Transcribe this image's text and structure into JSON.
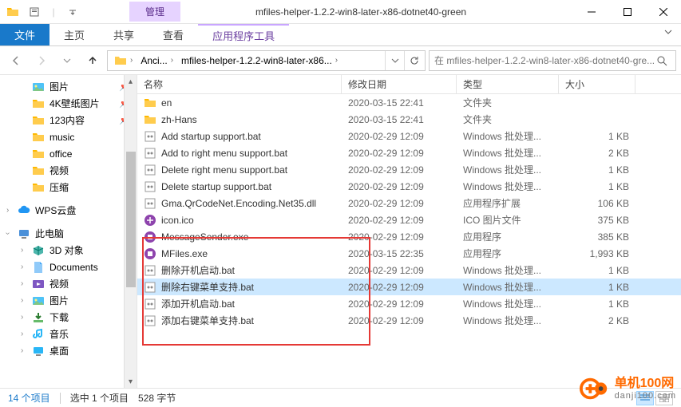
{
  "window": {
    "mgmt_tab": "管理",
    "title": "mfiles-helper-1.2.2-win8-later-x86-dotnet40-green",
    "tabs": {
      "file": "文件",
      "home": "主页",
      "share": "共享",
      "view": "查看",
      "app_tools": "应用程序工具"
    }
  },
  "address": {
    "segments": [
      "Anci...",
      "mfiles-helper-1.2.2-win8-later-x86..."
    ],
    "search_placeholder": "在 mfiles-helper-1.2.2-win8-later-x86-dotnet40-gre..."
  },
  "nav": {
    "items": [
      {
        "label": "图片",
        "icon": "pictures",
        "pinned": true,
        "level": 2
      },
      {
        "label": "4K壁纸图片",
        "icon": "folder",
        "pinned": true,
        "level": 2
      },
      {
        "label": "123内容",
        "icon": "folder",
        "pinned": true,
        "level": 2
      },
      {
        "label": "music",
        "icon": "folder",
        "level": 2
      },
      {
        "label": "office",
        "icon": "folder",
        "level": 2
      },
      {
        "label": "视频",
        "icon": "folder",
        "level": 2
      },
      {
        "label": "压缩",
        "icon": "folder",
        "level": 2
      }
    ],
    "wps": "WPS云盘",
    "thispc": "此电脑",
    "pc_children": [
      {
        "label": "3D 对象",
        "icon": "3d"
      },
      {
        "label": "Documents",
        "icon": "documents"
      },
      {
        "label": "视频",
        "icon": "videos"
      },
      {
        "label": "图片",
        "icon": "pictures"
      },
      {
        "label": "下载",
        "icon": "downloads"
      },
      {
        "label": "音乐",
        "icon": "music"
      },
      {
        "label": "桌面",
        "icon": "desktop"
      }
    ]
  },
  "columns": {
    "name": "名称",
    "date": "修改日期",
    "type": "类型",
    "size": "大小"
  },
  "files": [
    {
      "name": "en",
      "date": "2020-03-15 22:41",
      "type": "文件夹",
      "size": "",
      "icon": "folder"
    },
    {
      "name": "zh-Hans",
      "date": "2020-03-15 22:41",
      "type": "文件夹",
      "size": "",
      "icon": "folder"
    },
    {
      "name": "Add startup support.bat",
      "date": "2020-02-29 12:09",
      "type": "Windows 批处理...",
      "size": "1 KB",
      "icon": "bat"
    },
    {
      "name": "Add to right menu support.bat",
      "date": "2020-02-29 12:09",
      "type": "Windows 批处理...",
      "size": "2 KB",
      "icon": "bat"
    },
    {
      "name": "Delete right menu support.bat",
      "date": "2020-02-29 12:09",
      "type": "Windows 批处理...",
      "size": "1 KB",
      "icon": "bat"
    },
    {
      "name": "Delete startup support.bat",
      "date": "2020-02-29 12:09",
      "type": "Windows 批处理...",
      "size": "1 KB",
      "icon": "bat"
    },
    {
      "name": "Gma.QrCodeNet.Encoding.Net35.dll",
      "date": "2020-02-29 12:09",
      "type": "应用程序扩展",
      "size": "106 KB",
      "icon": "dll"
    },
    {
      "name": "icon.ico",
      "date": "2020-02-29 12:09",
      "type": "ICO 图片文件",
      "size": "375 KB",
      "icon": "ico"
    },
    {
      "name": "MessageSender.exe",
      "date": "2020-02-29 12:09",
      "type": "应用程序",
      "size": "385 KB",
      "icon": "exe"
    },
    {
      "name": "MFiles.exe",
      "date": "2020-03-15 22:35",
      "type": "应用程序",
      "size": "1,993 KB",
      "icon": "exe"
    },
    {
      "name": "删除开机启动.bat",
      "date": "2020-02-29 12:09",
      "type": "Windows 批处理...",
      "size": "1 KB",
      "icon": "bat"
    },
    {
      "name": "删除右键菜单支持.bat",
      "date": "2020-02-29 12:09",
      "type": "Windows 批处理...",
      "size": "1 KB",
      "icon": "bat",
      "selected": true
    },
    {
      "name": "添加开机启动.bat",
      "date": "2020-02-29 12:09",
      "type": "Windows 批处理...",
      "size": "1 KB",
      "icon": "bat"
    },
    {
      "name": "添加右键菜单支持.bat",
      "date": "2020-02-29 12:09",
      "type": "Windows 批处理...",
      "size": "2 KB",
      "icon": "bat"
    }
  ],
  "status": {
    "count": "14 个项目",
    "selected": "选中 1 个项目",
    "bytes": "528 字节"
  },
  "watermark": {
    "line1": "单机100网",
    "line2": "danji100.com"
  }
}
